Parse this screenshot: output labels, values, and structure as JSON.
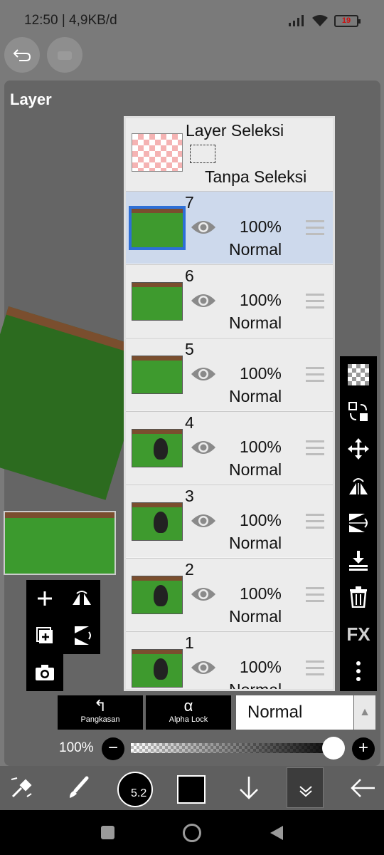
{
  "status_bar": {
    "time_info": "12:50 | 4,9KB/d",
    "battery": "19"
  },
  "panel": {
    "title": "Layer"
  },
  "selection_layer": {
    "title": "Layer Seleksi",
    "subtitle": "Tanpa Seleksi"
  },
  "layers": [
    {
      "number": "7",
      "opacity": "100%",
      "blend": "Normal",
      "selected": true
    },
    {
      "number": "6",
      "opacity": "100%",
      "blend": "Normal",
      "selected": false
    },
    {
      "number": "5",
      "opacity": "100%",
      "blend": "Normal",
      "selected": false
    },
    {
      "number": "4",
      "opacity": "100%",
      "blend": "Normal",
      "selected": false
    },
    {
      "number": "3",
      "opacity": "100%",
      "blend": "Normal",
      "selected": false
    },
    {
      "number": "2",
      "opacity": "100%",
      "blend": "Normal",
      "selected": false
    },
    {
      "number": "1",
      "opacity": "100%",
      "blend": "Normal",
      "selected": false
    }
  ],
  "right_tools": {
    "fx_label": "FX"
  },
  "bottom_panel": {
    "clip_label": "Pangkasan",
    "alpha_lock_label": "Alpha Lock",
    "blend_mode": "Normal",
    "opacity_label": "100%",
    "opacity_value": 1.0
  },
  "toolbar": {
    "brush_size": "5.2"
  },
  "colors": {
    "selected_row": "#cdd9ec",
    "selected_border": "#2d6fd6",
    "grass": "#3e9a2e"
  }
}
